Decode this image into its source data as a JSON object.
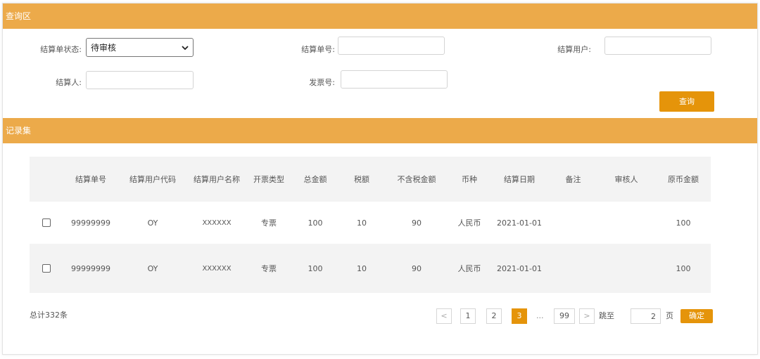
{
  "query_area": {
    "title": "查询区",
    "status_label": "结算单状态:",
    "status_value": "待审核",
    "order_no_label": "结算单号:",
    "order_no_value": "",
    "user_label": "结算用户:",
    "user_value": "",
    "settler_label": "结算人:",
    "settler_value": "",
    "invoice_label": "发票号:",
    "invoice_value": "",
    "query_button": "查询"
  },
  "records": {
    "title": "记录集",
    "columns": [
      "结算单号",
      "结算用户代码",
      "结算用户名称",
      "开票类型",
      "总金额",
      "税额",
      "不含税金额",
      "币种",
      "结算日期",
      "备注",
      "审核人",
      "原币金额"
    ],
    "rows": [
      [
        "99999999",
        "OY",
        "XXXXXX",
        "专票",
        "100",
        "10",
        "90",
        "人民币",
        "2021-01-01",
        "",
        "",
        "100"
      ],
      [
        "99999999",
        "OY",
        "XXXXXX",
        "专票",
        "100",
        "10",
        "90",
        "人民币",
        "2021-01-01",
        "",
        "",
        "100"
      ]
    ]
  },
  "pagination": {
    "total": "总计332条",
    "prev": "<",
    "pages": [
      "1",
      "2",
      "3"
    ],
    "active_page": "3",
    "ellipsis": "...",
    "last_page": "99",
    "next": ">",
    "jump_label": "跳至",
    "jump_value": "2",
    "page_unit": "页",
    "confirm": "确定"
  },
  "colors": {
    "header_bar": "#ecaa4a",
    "accent": "#e5940a",
    "row_alt": "#f3f3f3"
  }
}
